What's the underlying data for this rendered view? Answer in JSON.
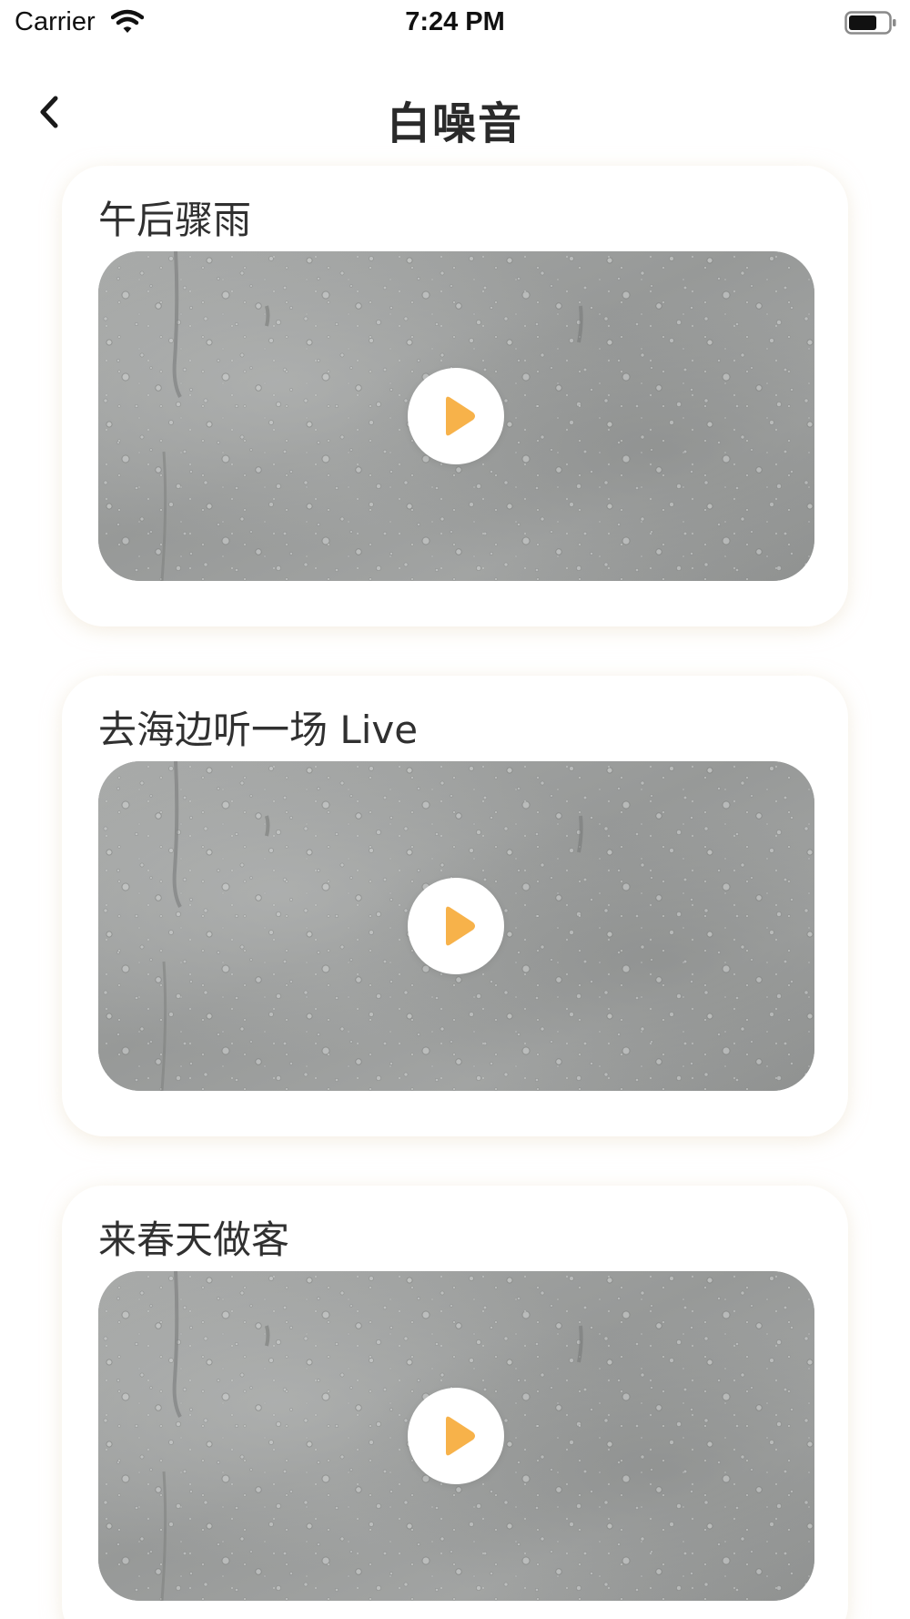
{
  "status_bar": {
    "carrier": "Carrier",
    "time": "7:24 PM",
    "icons": [
      "wifi-icon",
      "battery-icon"
    ]
  },
  "nav": {
    "back_icon": "chevron-left-icon",
    "title": "白噪音"
  },
  "sounds": [
    {
      "title": "午后骤雨",
      "action_icon": "play-icon"
    },
    {
      "title": "去海边听一场 Live",
      "action_icon": "play-icon"
    },
    {
      "title": "来春天做客",
      "action_icon": "play-icon"
    }
  ],
  "colors": {
    "accent": "#F7B24A",
    "title_text": "#2A2A2A",
    "card_background": "#FFFFFF",
    "card_shadow": "#EBDEC8"
  }
}
